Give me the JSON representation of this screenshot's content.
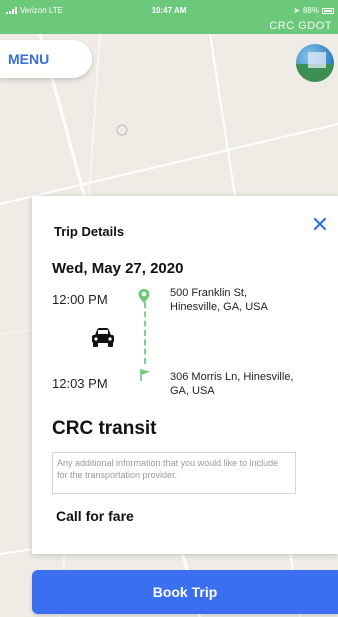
{
  "status_bar": {
    "carrier": "Verizon  LTE",
    "time": "10:47 AM",
    "battery": "88%",
    "app_title": "CRC GDOT"
  },
  "menu": {
    "label": "MENU"
  },
  "trip": {
    "header": "Trip Details",
    "close_label": "✕",
    "date": "Wed, May 27, 2020",
    "start_time": "12:00 PM",
    "start_address": "500 Franklin St, Hinesville, GA, USA",
    "end_time": "12:03 PM",
    "end_address": "306 Morris Ln, Hinesville, GA, USA",
    "provider": "CRC transit",
    "notes_placeholder": "Any additional information that you would like to include for the transportation provider.",
    "fare": "Call for fare"
  },
  "book_button": {
    "label": "Book Trip"
  },
  "colors": {
    "accent": "#3a6ff0",
    "status": "#6cc97c",
    "route": "#7fd48a"
  },
  "icons": [
    "signal-icon",
    "battery-icon",
    "pin-icon",
    "flag-icon",
    "car-icon",
    "close-icon"
  ]
}
